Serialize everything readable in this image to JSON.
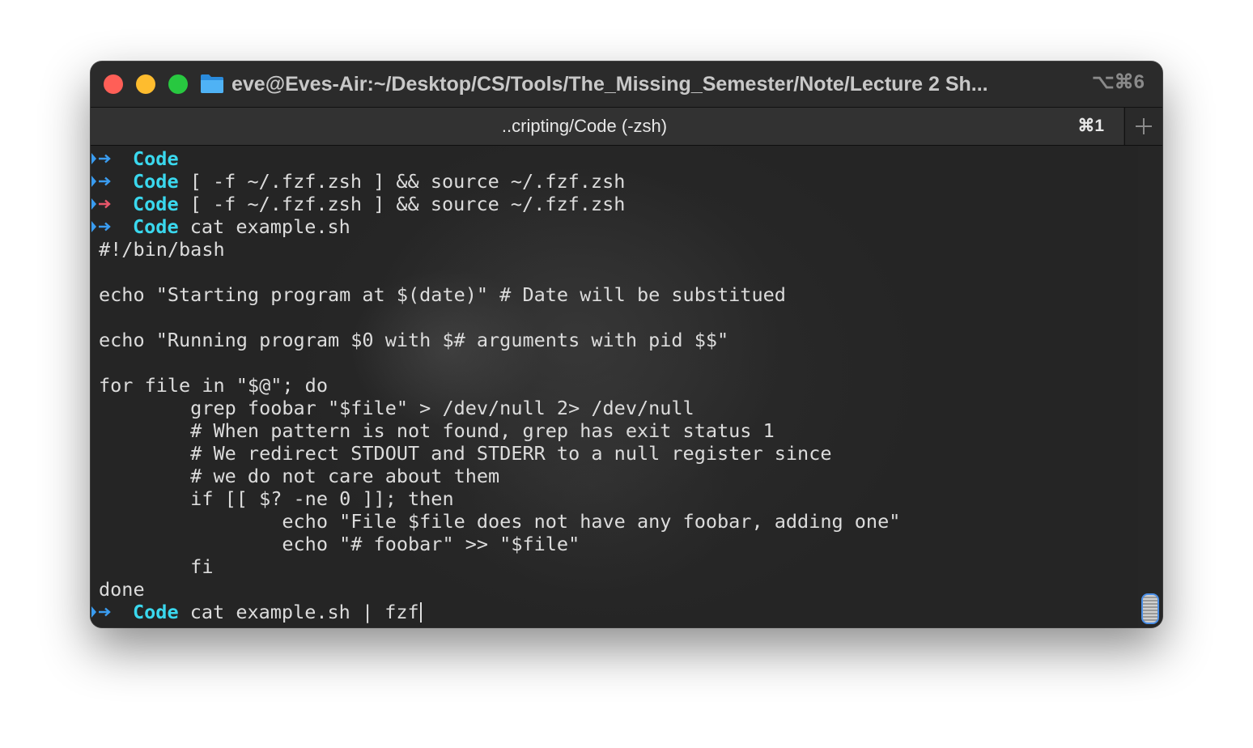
{
  "window": {
    "title": "eve@Eves-Air:~/Desktop/CS/Tools/The_Missing_Semester/Note/Lecture 2 Sh...",
    "shortcut": "⌥⌘6",
    "tab_label": "..cripting/Code (-zsh)",
    "tab_shortcut": "⌘1"
  },
  "colors": {
    "prompt_ok": "#3a9cf0",
    "prompt_error": "#e8566a",
    "directory": "#3ad8ee",
    "text": "#dcdcdc"
  },
  "terminal": {
    "lines": [
      {
        "type": "prompt",
        "status": "ok",
        "dir": "Code",
        "command": ""
      },
      {
        "type": "prompt",
        "status": "ok",
        "dir": "Code",
        "command": " [ -f ~/.fzf.zsh ] && source ~/.fzf.zsh"
      },
      {
        "type": "prompt",
        "status": "error",
        "dir": "Code",
        "command": " [ -f ~/.fzf.zsh ] && source ~/.fzf.zsh"
      },
      {
        "type": "prompt",
        "status": "ok",
        "dir": "Code",
        "command": " cat example.sh"
      },
      {
        "type": "output",
        "text": "#!/bin/bash"
      },
      {
        "type": "output",
        "text": ""
      },
      {
        "type": "output",
        "text": "echo \"Starting program at $(date)\" # Date will be substitued"
      },
      {
        "type": "output",
        "text": ""
      },
      {
        "type": "output",
        "text": "echo \"Running program $0 with $# arguments with pid $$\""
      },
      {
        "type": "output",
        "text": ""
      },
      {
        "type": "output",
        "text": "for file in \"$@\"; do"
      },
      {
        "type": "output",
        "text": "        grep foobar \"$file\" > /dev/null 2> /dev/null"
      },
      {
        "type": "output",
        "text": "        # When pattern is not found, grep has exit status 1"
      },
      {
        "type": "output",
        "text": "        # We redirect STDOUT and STDERR to a null register since"
      },
      {
        "type": "output",
        "text": "        # we do not care about them"
      },
      {
        "type": "output",
        "text": "        if [[ $? -ne 0 ]]; then"
      },
      {
        "type": "output",
        "text": "                echo \"File $file does not have any foobar, adding one\""
      },
      {
        "type": "output",
        "text": "                echo \"# foobar\" >> \"$file\""
      },
      {
        "type": "output",
        "text": "        fi"
      },
      {
        "type": "output",
        "text": "done"
      },
      {
        "type": "prompt",
        "status": "ok",
        "dir": "Code",
        "command": " cat example.sh | fzf",
        "cursor": true
      }
    ]
  }
}
